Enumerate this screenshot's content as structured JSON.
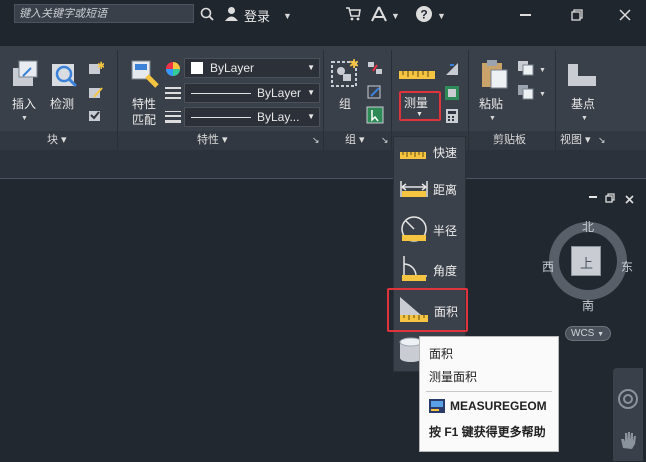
{
  "titlebar": {
    "search_placeholder": "键入关键字或短语",
    "login_label": "登录",
    "help_icon": "question-icon"
  },
  "ribbon": {
    "block": {
      "insert_label": "插入",
      "detect_label": "检测",
      "panel_label": "块"
    },
    "properties": {
      "match_label_1": "特性",
      "match_label_2": "匹配",
      "layer_color_value": "ByLayer",
      "linetype_value": "ByLayer",
      "lineweight_value": "ByLay...",
      "panel_label": "特性"
    },
    "group": {
      "group_label": "组",
      "panel_label": "组"
    },
    "measure": {
      "measure_label": "测量"
    },
    "clipboard": {
      "paste_label": "粘贴",
      "panel_label": "剪贴板"
    },
    "view": {
      "base_label": "基点",
      "panel_label": "视图"
    }
  },
  "measure_menu": {
    "items": [
      {
        "label": "快速",
        "icon": "ruler-quick-icon"
      },
      {
        "label": "距离",
        "icon": "distance-icon"
      },
      {
        "label": "半径",
        "icon": "radius-icon"
      },
      {
        "label": "角度",
        "icon": "angle-icon"
      },
      {
        "label": "面积",
        "icon": "area-icon"
      }
    ],
    "volume_icon": "volume-cylinder-icon"
  },
  "tooltip": {
    "title": "面积",
    "description": "测量面积",
    "command": "MEASUREGEOM",
    "help_text": "按 F1 键获得更多帮助"
  },
  "viewcube": {
    "north": "北",
    "south": "南",
    "east": "东",
    "west": "西",
    "face": "上",
    "wcs_label": "WCS"
  },
  "colors": {
    "background": "#212830",
    "ribbon": "#3a4049",
    "highlight_red": "#e0343c"
  }
}
